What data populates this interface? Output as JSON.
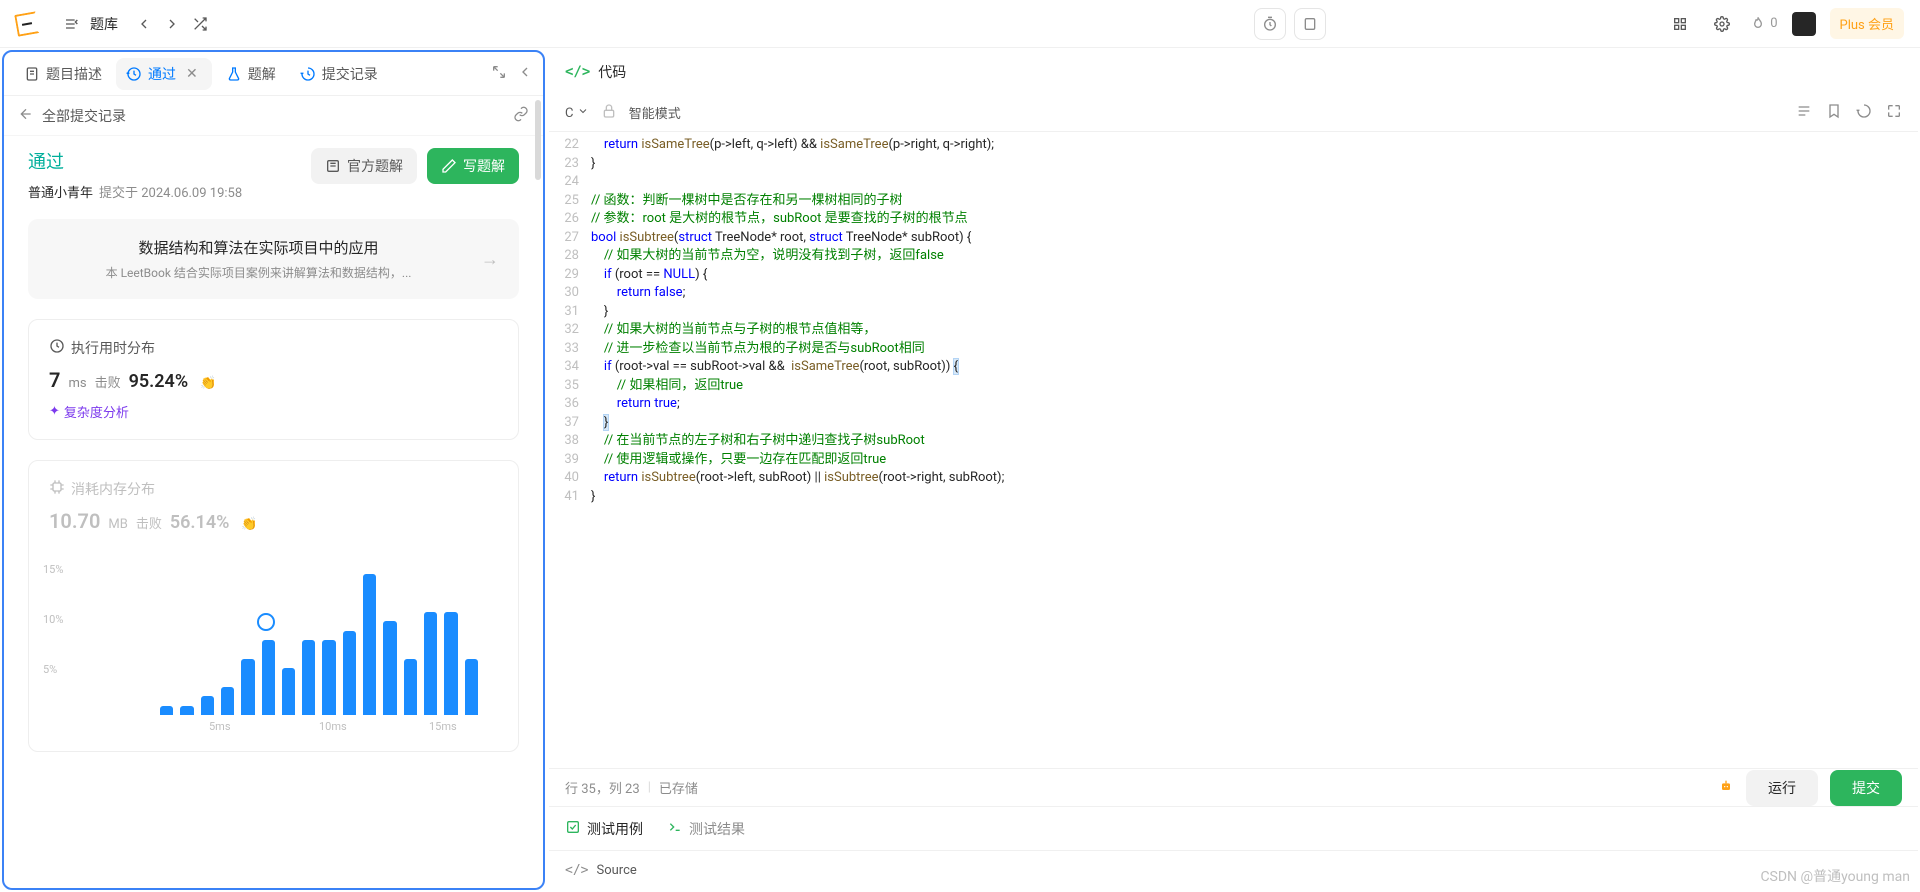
{
  "top": {
    "problem_bank_label": "题库",
    "fire_count": "0",
    "plus_label": "Plus 会员"
  },
  "left": {
    "tabs": {
      "desc": "题目描述",
      "pass": "通过",
      "solution": "题解",
      "submissions": "提交记录"
    },
    "breadcrumb": "全部提交记录",
    "status": "通过",
    "username": "普通小青年",
    "submit_meta": "提交于 2024.06.09 19:58",
    "btn_official": "官方题解",
    "btn_write": "写题解",
    "promo_title": "数据结构和算法在实际项目中的应用",
    "promo_sub": "本 LeetBook 结合实际项目案例来讲解算法和数据结构，...",
    "runtime_title": "执行用时分布",
    "runtime_value": "7",
    "runtime_unit": "ms",
    "runtime_beat_label": "击败",
    "runtime_beat_pct": "95.24%",
    "complexity_link": "复杂度分析",
    "memory_title": "消耗内存分布",
    "memory_value": "10.70",
    "memory_unit": "MB",
    "memory_beat_label": "击败",
    "memory_beat_pct": "56.14%"
  },
  "chart_data": {
    "type": "bar",
    "ylabel_pct": [
      "15%",
      "10%",
      "5%"
    ],
    "x_ticks": [
      "5ms",
      "10ms",
      "15ms"
    ],
    "values": [
      0,
      0,
      0,
      1,
      1,
      2,
      3,
      6,
      8,
      5,
      8,
      8,
      9,
      15,
      10,
      6,
      11,
      11,
      6
    ],
    "ylim": [
      0,
      16
    ]
  },
  "code": {
    "header": "代码",
    "lang": "C",
    "mode": "智能模式",
    "status_bar": {
      "pos": "行 35，列 23",
      "save": "已存储"
    },
    "btn_run": "运行",
    "btn_submit": "提交",
    "tab_cases": "测试用例",
    "tab_results": "测试结果",
    "source_label": "Source",
    "start_line": 22,
    "lines": [
      [
        {
          "t": "    ",
          "c": ""
        },
        {
          "t": "return",
          "c": "kw"
        },
        {
          "t": " ",
          "c": ""
        },
        {
          "t": "isSameTree",
          "c": "fn"
        },
        {
          "t": "(p->left, q->left) && ",
          "c": ""
        },
        {
          "t": "isSameTree",
          "c": "fn"
        },
        {
          "t": "(p->right, q->right);",
          "c": ""
        }
      ],
      [
        {
          "t": "}",
          "c": ""
        }
      ],
      [
        {
          "t": "",
          "c": ""
        }
      ],
      [
        {
          "t": "// 函数：判断一棵树中是否存在和另一棵树相同的子树",
          "c": "cm"
        }
      ],
      [
        {
          "t": "// 参数：root 是大树的根节点，subRoot 是要查找的子树的根节点",
          "c": "cm"
        }
      ],
      [
        {
          "t": "bool",
          "c": "kw"
        },
        {
          "t": " ",
          "c": ""
        },
        {
          "t": "isSubtree",
          "c": "fn"
        },
        {
          "t": "(",
          "c": ""
        },
        {
          "t": "struct",
          "c": "kw"
        },
        {
          "t": " TreeNode* root, ",
          "c": ""
        },
        {
          "t": "struct",
          "c": "kw"
        },
        {
          "t": " TreeNode* subRoot) {",
          "c": ""
        }
      ],
      [
        {
          "t": "    ",
          "c": ""
        },
        {
          "t": "// 如果大树的当前节点为空，说明没有找到子树，返回false",
          "c": "cm"
        }
      ],
      [
        {
          "t": "    ",
          "c": ""
        },
        {
          "t": "if",
          "c": "kw"
        },
        {
          "t": " (root == ",
          "c": ""
        },
        {
          "t": "NULL",
          "c": "kw"
        },
        {
          "t": ") {",
          "c": ""
        }
      ],
      [
        {
          "t": "        ",
          "c": ""
        },
        {
          "t": "return",
          "c": "kw"
        },
        {
          "t": " ",
          "c": ""
        },
        {
          "t": "false",
          "c": "kw"
        },
        {
          "t": ";",
          "c": ""
        }
      ],
      [
        {
          "t": "    }",
          "c": ""
        }
      ],
      [
        {
          "t": "    ",
          "c": ""
        },
        {
          "t": "// 如果大树的当前节点与子树的根节点值相等，",
          "c": "cm"
        }
      ],
      [
        {
          "t": "    ",
          "c": ""
        },
        {
          "t": "// 进一步检查以当前节点为根的子树是否与subRoot相同",
          "c": "cm"
        }
      ],
      [
        {
          "t": "    ",
          "c": ""
        },
        {
          "t": "if",
          "c": "kw"
        },
        {
          "t": " (root->val == subRoot->val &&  ",
          "c": ""
        },
        {
          "t": "isSameTree",
          "c": "fn"
        },
        {
          "t": "(root, subRoot)) ",
          "c": ""
        },
        {
          "t": "{",
          "c": "hl-bracket"
        }
      ],
      [
        {
          "t": "        ",
          "c": ""
        },
        {
          "t": "// 如果相同，返回true",
          "c": "cm"
        }
      ],
      [
        {
          "t": "        ",
          "c": ""
        },
        {
          "t": "return",
          "c": "kw"
        },
        {
          "t": " ",
          "c": ""
        },
        {
          "t": "true",
          "c": "kw"
        },
        {
          "t": ";",
          "c": ""
        }
      ],
      [
        {
          "t": "    ",
          "c": ""
        },
        {
          "t": "}",
          "c": "hl-bracket"
        }
      ],
      [
        {
          "t": "    ",
          "c": ""
        },
        {
          "t": "// 在当前节点的左子树和右子树中递归查找子树subRoot",
          "c": "cm"
        }
      ],
      [
        {
          "t": "    ",
          "c": ""
        },
        {
          "t": "// 使用逻辑或操作，只要一边存在匹配即返回true",
          "c": "cm"
        }
      ],
      [
        {
          "t": "    ",
          "c": ""
        },
        {
          "t": "return",
          "c": "kw"
        },
        {
          "t": " ",
          "c": ""
        },
        {
          "t": "isSubtree",
          "c": "fn"
        },
        {
          "t": "(root->left, subRoot) || ",
          "c": ""
        },
        {
          "t": "isSubtree",
          "c": "fn"
        },
        {
          "t": "(root->right, subRoot);",
          "c": ""
        }
      ],
      [
        {
          "t": "}",
          "c": ""
        }
      ]
    ]
  },
  "watermark": "CSDN @普通young man"
}
